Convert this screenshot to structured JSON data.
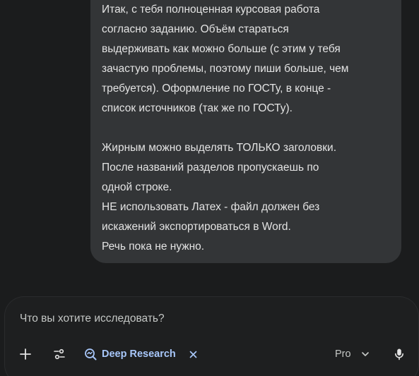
{
  "message": {
    "lines": [
      "Итак, с тебя полноценная курсовая работа",
      "согласно заданию. Объём стараться",
      "выдерживать как можно больше (с этим у тебя",
      "зачастую проблемы, поэтому пиши больше, чем",
      "требуется). Оформление по ГОСТу, в конце -",
      "список источников (так же по ГОСТу).",
      "",
      "Жирным можно выделять ТОЛЬКО заголовки.",
      "После названий разделов пропускаешь по",
      "одной строке.",
      "НЕ использовать Латех - файл должен без",
      "искажений экспортироваться в Word.",
      "Речь пока не нужно."
    ]
  },
  "composer": {
    "placeholder": "Что вы хотите исследовать?",
    "value": "",
    "chip_label": "Deep Research",
    "model_label": "Pro"
  },
  "icons": {
    "plus": "plus-icon",
    "tools": "tools-icon",
    "deep_research": "deep-research-icon",
    "close": "close-icon",
    "chevron": "chevron-down-icon",
    "mic": "microphone-icon"
  },
  "colors": {
    "background": "#1b1c1d",
    "bubble": "#333537",
    "composer": "#1e1f20",
    "text": "#e3e3e3",
    "accent": "#a8c7fa"
  }
}
